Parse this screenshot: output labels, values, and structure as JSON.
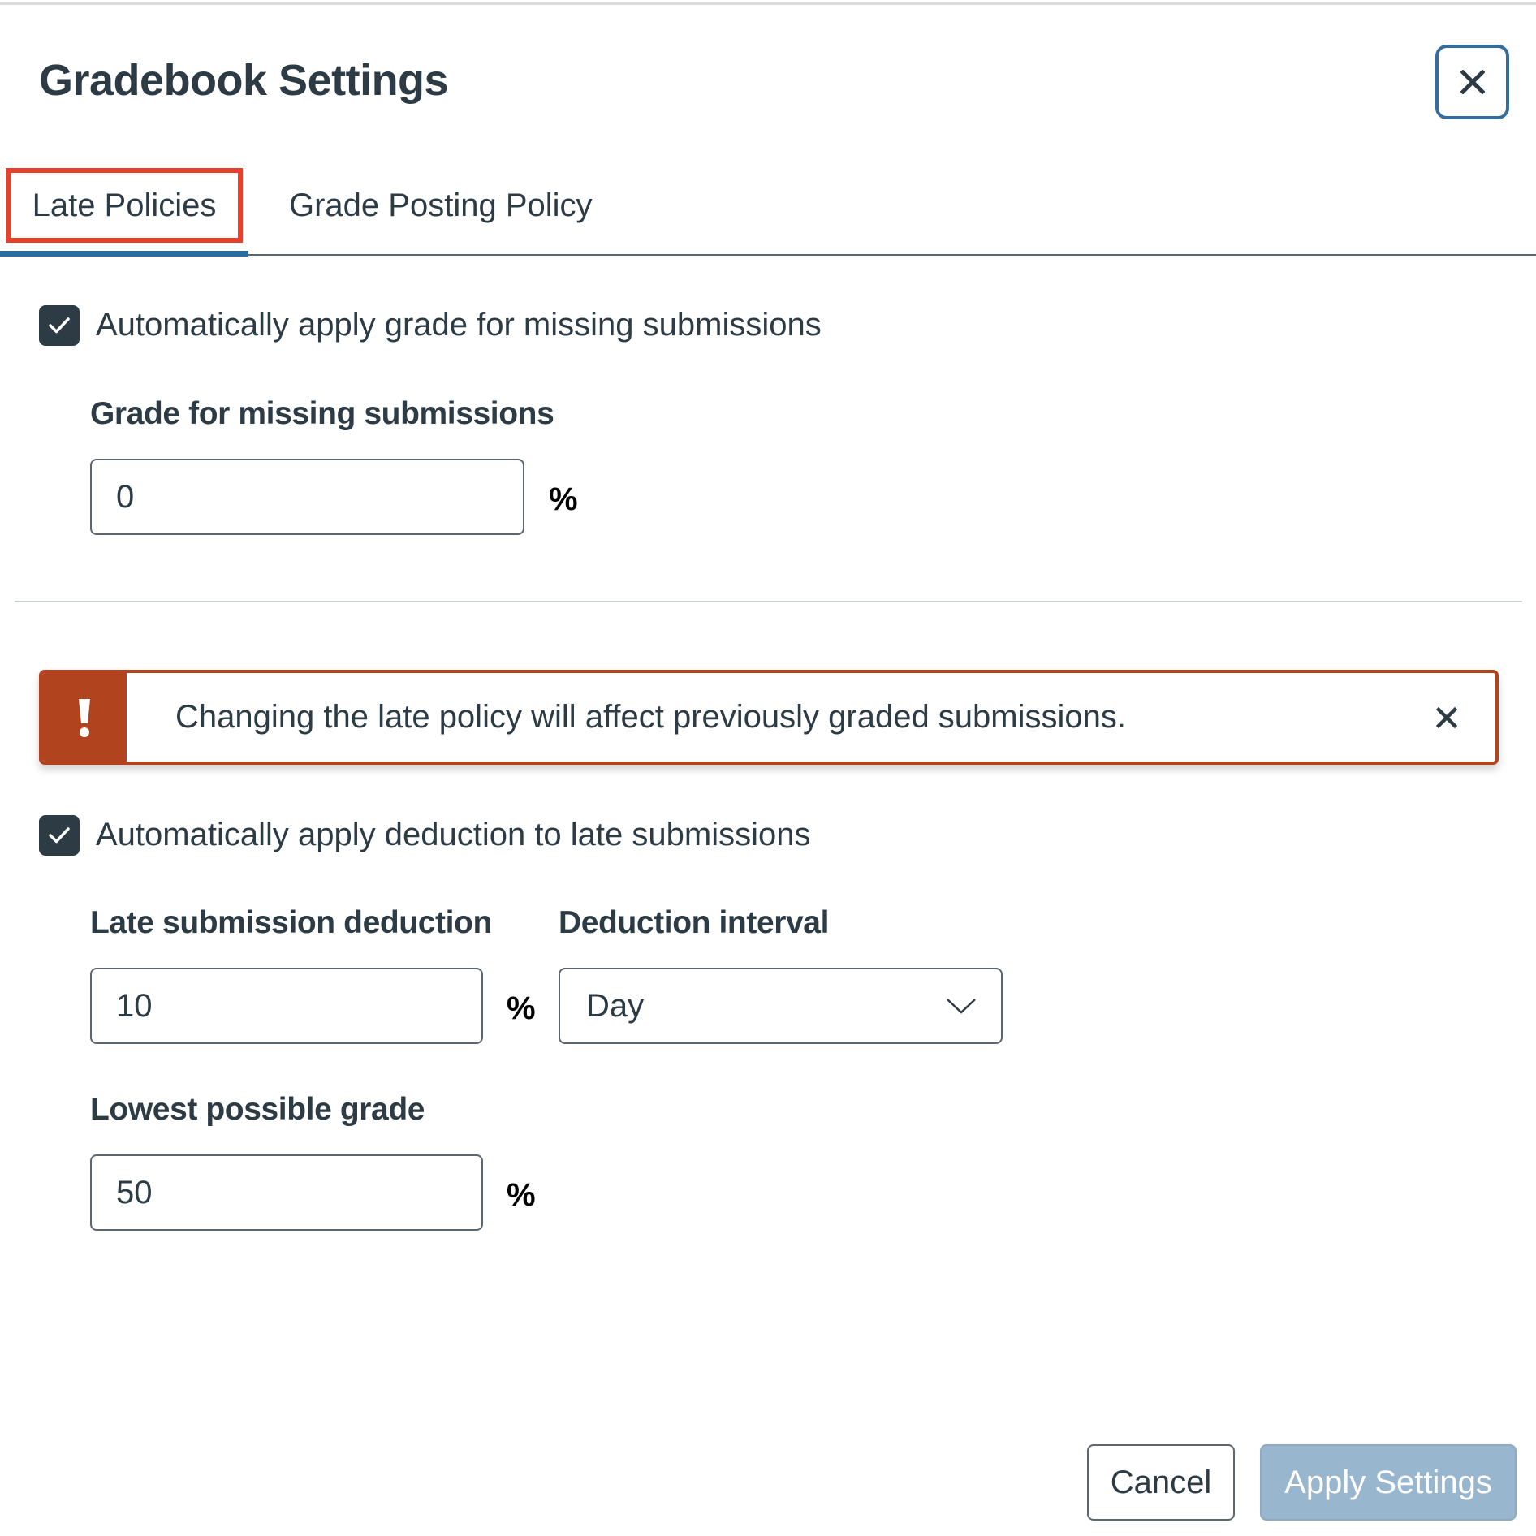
{
  "dialog": {
    "title": "Gradebook Settings",
    "close_icon": "close-icon"
  },
  "tabs": [
    {
      "label": "Late Policies",
      "selected": true,
      "highlighted": true
    },
    {
      "label": "Grade Posting Policy",
      "selected": false
    }
  ],
  "missing": {
    "checkbox_label": "Automatically apply grade for missing submissions",
    "checked": true,
    "grade_label": "Grade for missing submissions",
    "grade_value": "0",
    "unit": "%"
  },
  "alert": {
    "icon": "warning-exclamation-icon",
    "message": "Changing the late policy will affect previously graded submissions.",
    "close_icon": "close-icon"
  },
  "late": {
    "checkbox_label": "Automatically apply deduction to late submissions",
    "checked": true,
    "deduction_label": "Late submission deduction",
    "deduction_value": "10",
    "deduction_unit": "%",
    "interval_label": "Deduction interval",
    "interval_value": "Day",
    "lowest_label": "Lowest possible grade",
    "lowest_value": "50",
    "lowest_unit": "%"
  },
  "footer": {
    "cancel_label": "Cancel",
    "apply_label": "Apply Settings"
  },
  "colors": {
    "text": "#2d3b45",
    "brand_blue": "#2b6d9e",
    "highlight_red": "#e8402a",
    "alert_orange": "#b1441f",
    "apply_disabled": "#99b6cf"
  }
}
